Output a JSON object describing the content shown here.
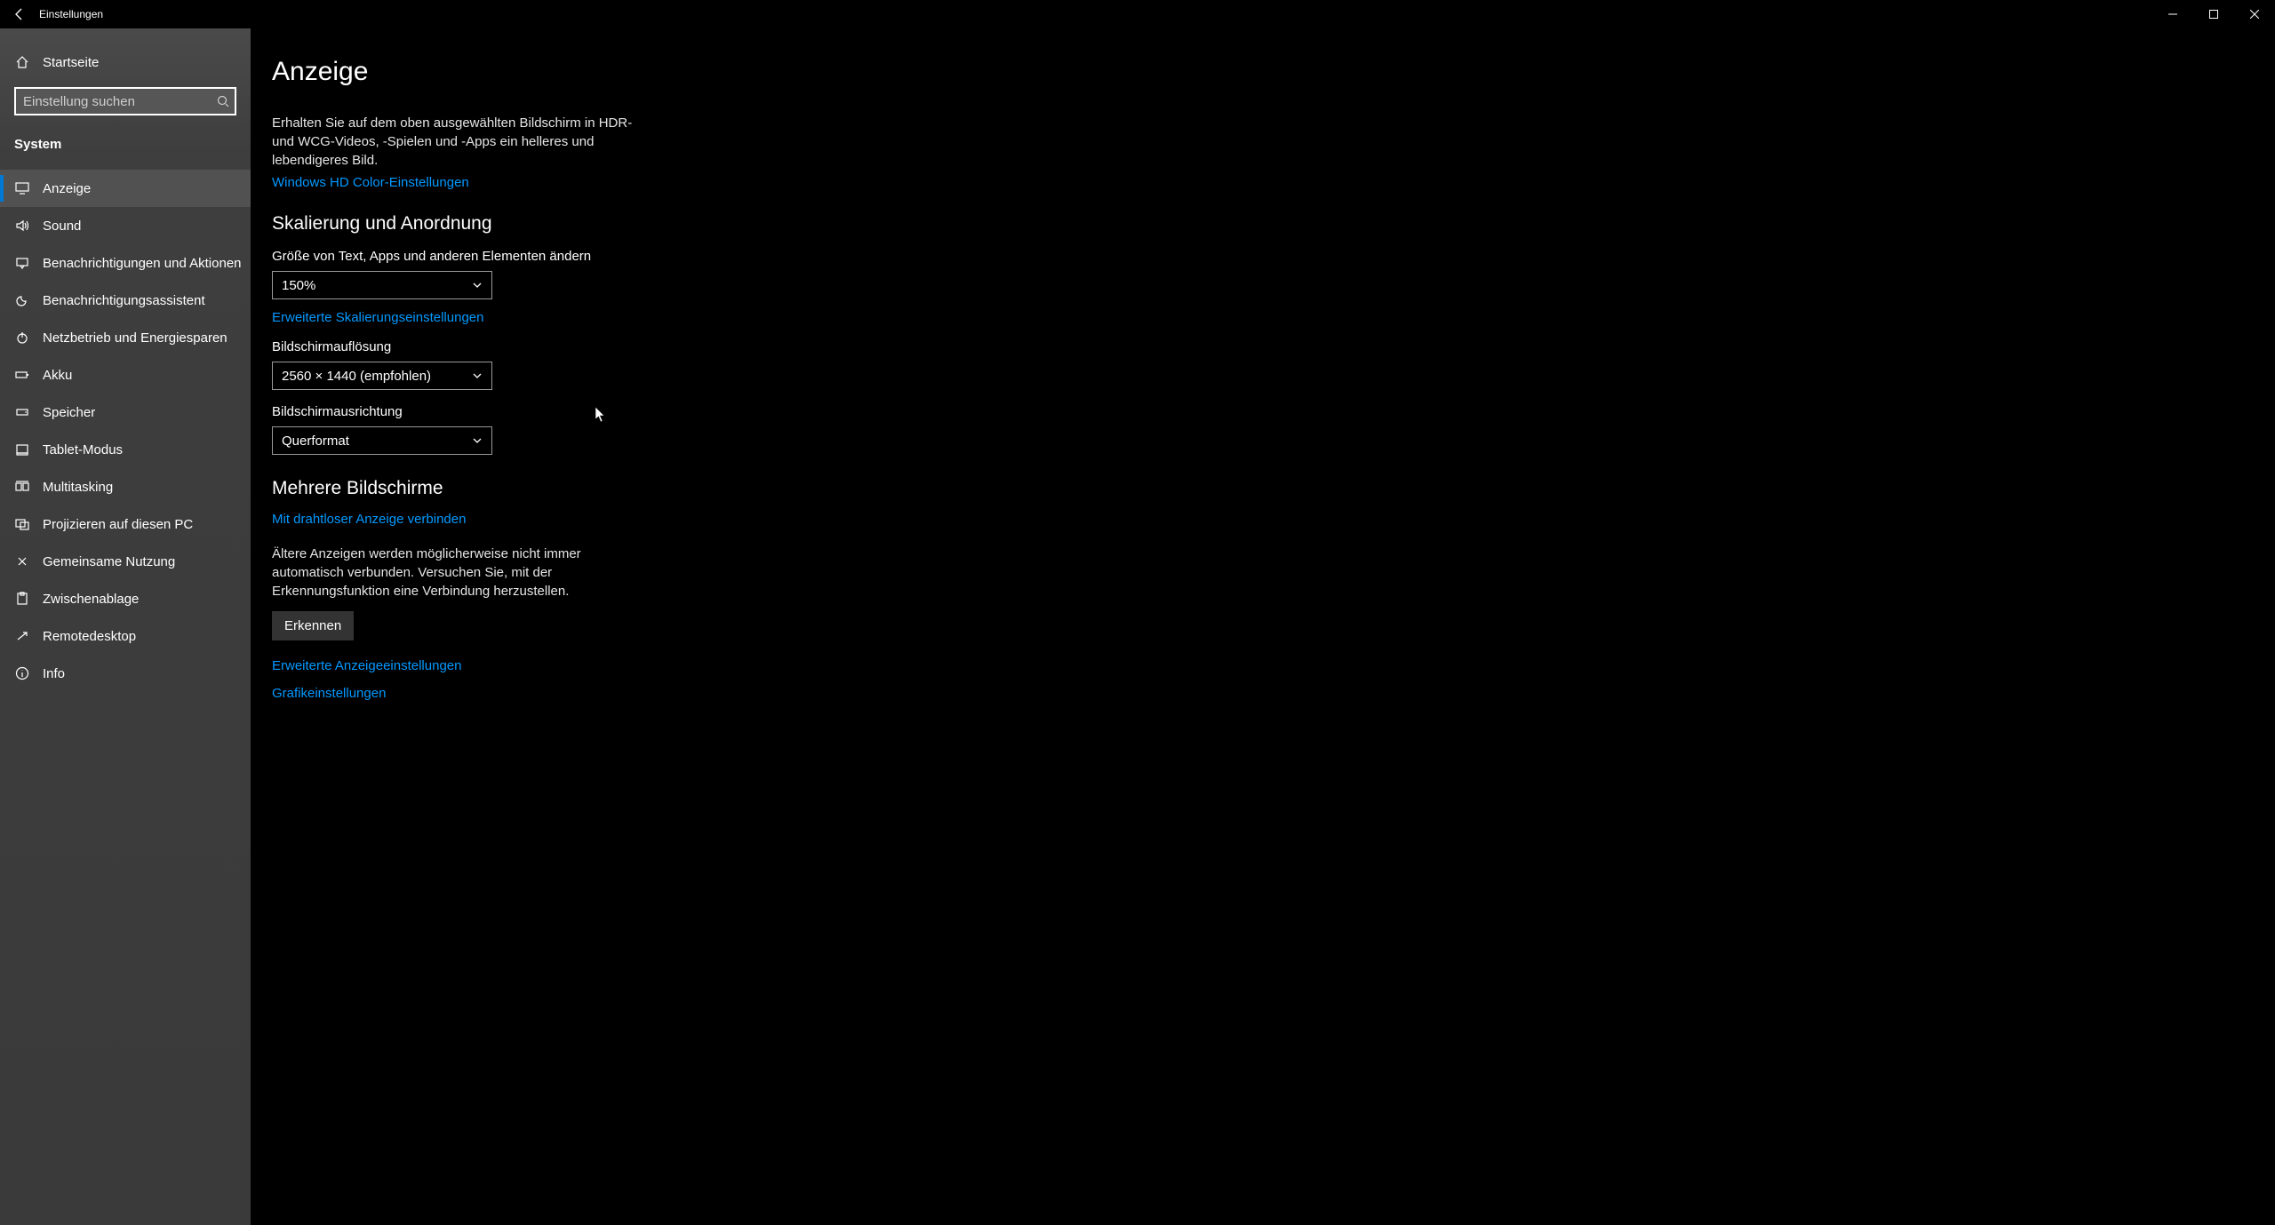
{
  "titlebar": {
    "title": "Einstellungen"
  },
  "sidebar": {
    "home": "Startseite",
    "search_placeholder": "Einstellung suchen",
    "category": "System",
    "items": [
      {
        "icon": "display",
        "label": "Anzeige",
        "selected": true
      },
      {
        "icon": "sound",
        "label": "Sound"
      },
      {
        "icon": "notifications",
        "label": "Benachrichtigungen und Aktionen"
      },
      {
        "icon": "focus-assist",
        "label": "Benachrichtigungsassistent"
      },
      {
        "icon": "power",
        "label": "Netzbetrieb und Energiesparen"
      },
      {
        "icon": "battery",
        "label": "Akku"
      },
      {
        "icon": "storage",
        "label": "Speicher"
      },
      {
        "icon": "tablet",
        "label": "Tablet-Modus"
      },
      {
        "icon": "multitasking",
        "label": "Multitasking"
      },
      {
        "icon": "project",
        "label": "Projizieren auf diesen PC"
      },
      {
        "icon": "shared",
        "label": "Gemeinsame Nutzung"
      },
      {
        "icon": "clipboard",
        "label": "Zwischenablage"
      },
      {
        "icon": "remote",
        "label": "Remotedesktop"
      },
      {
        "icon": "info",
        "label": "Info"
      }
    ]
  },
  "main": {
    "title": "Anzeige",
    "hdr_desc": "Erhalten Sie auf dem oben ausgewählten Bildschirm in HDR- und WCG-Videos, -Spielen und -Apps ein helleres und lebendigeres Bild.",
    "hdr_link": "Windows HD Color-Einstellungen",
    "scale_heading": "Skalierung und Anordnung",
    "scale_label": "Größe von Text, Apps und anderen Elementen ändern",
    "scale_value": "150%",
    "scale_link": "Erweiterte Skalierungseinstellungen",
    "resolution_label": "Bildschirmauflösung",
    "resolution_value": "2560 × 1440 (empfohlen)",
    "orientation_label": "Bildschirmausrichtung",
    "orientation_value": "Querformat",
    "multi_heading": "Mehrere Bildschirme",
    "wireless_link": "Mit drahtloser Anzeige verbinden",
    "detect_desc": "Ältere Anzeigen werden möglicherweise nicht immer automatisch verbunden. Versuchen Sie, mit der Erkennungsfunktion eine Verbindung herzustellen.",
    "detect_btn": "Erkennen",
    "advanced_link": "Erweiterte Anzeigeeinstellungen",
    "graphics_link": "Grafikeinstellungen"
  }
}
